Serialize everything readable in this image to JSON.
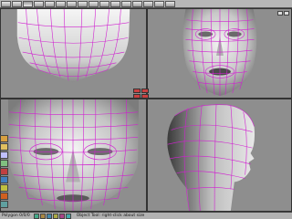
{
  "status": {
    "text": "Polygon 0/0/0",
    "hint": "Object Tool: right-click about size"
  },
  "colors": {
    "wire": "#d020d0",
    "skin_light": "#f0f0f0",
    "skin_mid": "#bdbdbd",
    "skin_dark": "#6a6a6a",
    "viewport_bg": "#8e8e8e"
  },
  "toolbar": {
    "buttons": [
      {
        "icon": "file-icon"
      },
      {
        "icon": "select-icon"
      },
      {
        "icon": "move-icon"
      },
      {
        "icon": "rotate-icon"
      },
      {
        "icon": "scale-icon"
      },
      {
        "icon": "polygon-icon"
      },
      {
        "icon": "edge-icon"
      },
      {
        "icon": "vertex-icon"
      },
      {
        "icon": "camera-icon"
      },
      {
        "icon": "light-icon"
      },
      {
        "icon": "render-icon"
      },
      {
        "icon": "material-icon"
      },
      {
        "icon": "grid-icon"
      },
      {
        "icon": "snap-icon"
      },
      {
        "icon": "view-icon"
      },
      {
        "icon": "settings-icon"
      }
    ]
  },
  "left_tools": [
    {
      "icon": "brush-icon",
      "color": "#d8a040"
    },
    {
      "icon": "pencil-icon",
      "color": "#e0c060"
    },
    {
      "icon": "eraser-icon",
      "color": "#c0c0ff"
    },
    {
      "icon": "smooth-icon",
      "color": "#80c080"
    },
    {
      "icon": "knife-icon",
      "color": "#c04040"
    },
    {
      "icon": "extrude-icon",
      "color": "#4080c0"
    },
    {
      "icon": "bevel-icon",
      "color": "#c0c040"
    },
    {
      "icon": "weld-icon",
      "color": "#d06020"
    },
    {
      "icon": "bridge-icon",
      "color": "#60a0a0"
    }
  ],
  "status_icons": [
    {
      "icon": "grid-icon",
      "color": "#4a8"
    },
    {
      "icon": "snap-icon",
      "color": "#a84"
    },
    {
      "icon": "lock-icon",
      "color": "#48a"
    },
    {
      "icon": "eye-icon",
      "color": "#aa4"
    },
    {
      "icon": "light-icon",
      "color": "#a48"
    },
    {
      "icon": "camera-icon",
      "color": "#4aa"
    }
  ]
}
